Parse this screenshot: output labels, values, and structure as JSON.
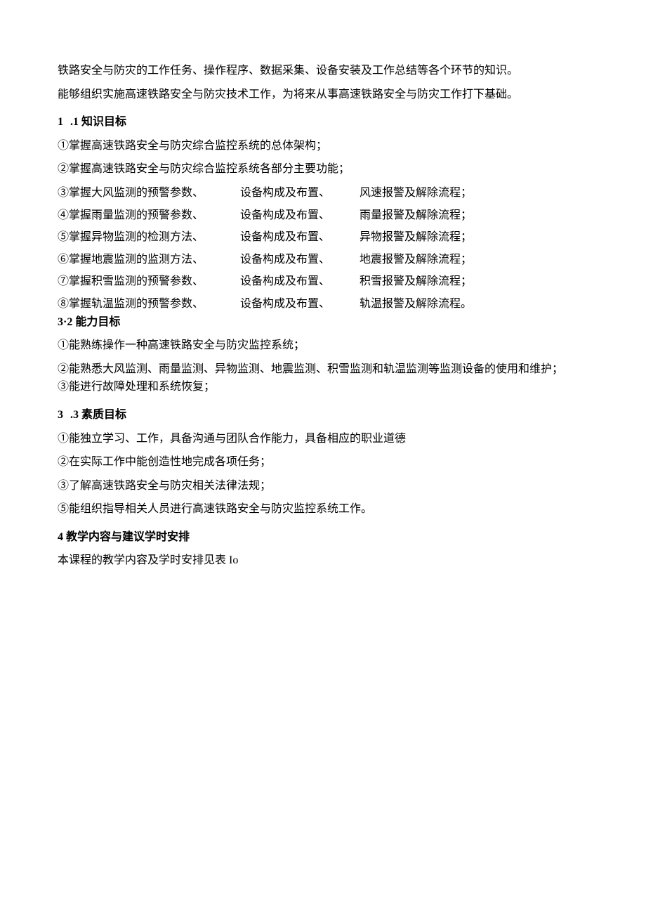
{
  "intro": {
    "p1": "铁路安全与防灾的工作任务、操作程序、数据采集、设备安装及工作总结等各个环节的知识。",
    "p2": "能够组织实施高速铁路安全与防灾技术工作，为将来从事高速铁路安全与防灾工作打下基础。"
  },
  "h_knowledge": {
    "num": "1",
    "title": " .1 知识目标"
  },
  "knowledge": {
    "k1": "①掌握高速铁路安全与防灾综合监控系统的总体架构；",
    "k2": "②掌握高速铁路安全与防灾综合监控系统各部分主要功能；",
    "k3a": "③掌握大风监测的预警参数、",
    "k3b": "设备构成及布置、",
    "k3c": "风速报警及解除流程；",
    "k4a": "④掌握雨量监测的预警参数、",
    "k4b": "设备构成及布置、",
    "k4c": "雨量报警及解除流程；",
    "k5a": "⑤掌握异物监测的检测方法、",
    "k5b": "设备构成及布置、",
    "k5c": "异物报警及解除流程；",
    "k6a": "⑥掌握地震监测的监测方法、",
    "k6b": "设备构成及布置、",
    "k6c": "地震报警及解除流程；",
    "k7a": "⑦掌握积雪监测的预警参数、",
    "k7b": "设备构成及布置、",
    "k7c": "积雪报警及解除流程；",
    "k8a": "⑧掌握轨温监测的预警参数、",
    "k8b": "设备构成及布置、",
    "k8c": "轨温报警及解除流程。"
  },
  "h_ability": "3·2 能力目标",
  "ability": {
    "a1": "①能熟练操作一种高速铁路安全与防灾监控系统；",
    "a2": "②能熟悉大风监测、雨量监测、异物监测、地震监测、积雪监测和轨温监测等监测设备的使用和维护；",
    "a3": "③能进行故障处理和系统恢复；"
  },
  "h_quality": {
    "num": "3",
    "title": " .3 素质目标"
  },
  "quality": {
    "q1": "①能独立学习、工作，具备沟通与团队合作能力，具备相应的职业道德",
    "q2": "②在实际工作中能创造性地完成各项任务；",
    "q3": "③了解高速铁路安全与防灾相关法律法规；",
    "q5": "⑤能组织指导相关人员进行高速铁路安全与防灾监控系统工作。"
  },
  "h_teach": "4 教学内容与建议学时安排",
  "teach": {
    "p1": "本课程的教学内容及学时安排见表 Io"
  }
}
